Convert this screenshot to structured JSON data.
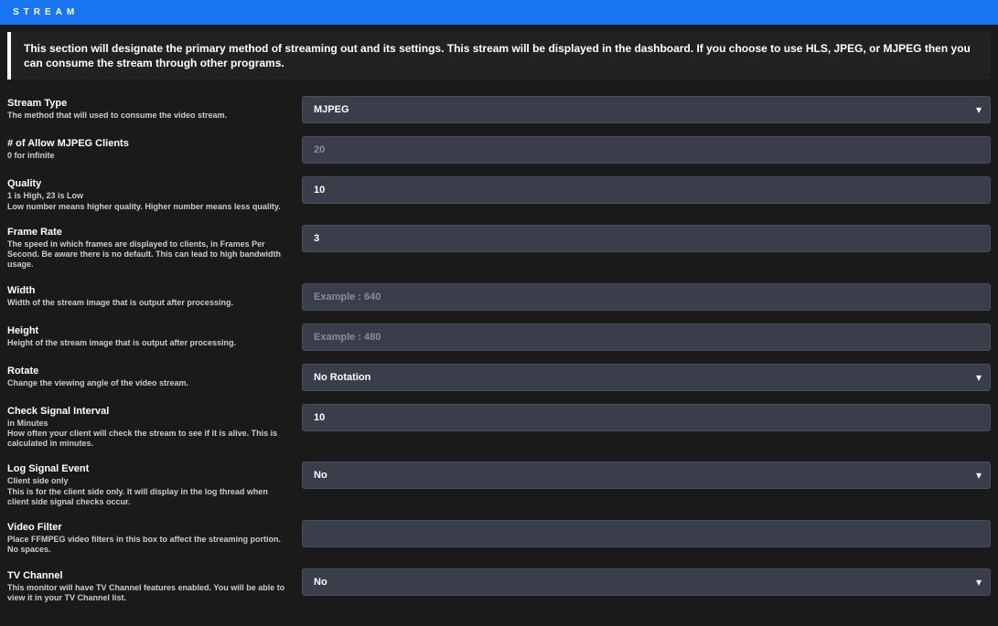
{
  "header": {
    "title": "STREAM"
  },
  "info": "This section will designate the primary method of streaming out and its settings. This stream will be displayed in the dashboard. If you choose to use HLS, JPEG, or MJPEG then you can consume the stream through other programs.",
  "fields": {
    "streamType": {
      "label": "Stream Type",
      "desc": "The method that will used to consume the video stream.",
      "value": "MJPEG"
    },
    "mjpegClients": {
      "label": "# of Allow MJPEG Clients",
      "desc": "0 for infinite",
      "placeholder": "20",
      "value": ""
    },
    "quality": {
      "label": "Quality",
      "desc": "1 is High, 23 is Low",
      "desc2": "Low number means higher quality. Higher number means less quality.",
      "value": "10"
    },
    "frameRate": {
      "label": "Frame Rate",
      "desc": "The speed in which frames are displayed to clients, in Frames Per Second. Be aware there is no default. This can lead to high bandwidth usage.",
      "value": "3"
    },
    "width": {
      "label": "Width",
      "desc": "Width of the stream image that is output after processing.",
      "placeholder": "Example : 640",
      "value": ""
    },
    "height": {
      "label": "Height",
      "desc": "Height of the stream image that is output after processing.",
      "placeholder": "Example : 480",
      "value": ""
    },
    "rotate": {
      "label": "Rotate",
      "desc": "Change the viewing angle of the video stream.",
      "value": "No Rotation"
    },
    "checkSignal": {
      "label": "Check Signal Interval",
      "desc": "in Minutes",
      "desc2": "How often your client will check the stream to see if it is alive. This is calculated in minutes.",
      "value": "10"
    },
    "logSignal": {
      "label": "Log Signal Event",
      "desc": "Client side only",
      "desc2": "This is for the client side only. It will display in the log thread when client side signal checks occur.",
      "value": "No"
    },
    "videoFilter": {
      "label": "Video Filter",
      "desc": "Place FFMPEG video filters in this box to affect the streaming portion. No spaces.",
      "value": ""
    },
    "tvChannel": {
      "label": "TV Channel",
      "desc": "This monitor will have TV Channel features enabled. You will be able to view it in your TV Channel list.",
      "value": "No"
    }
  }
}
